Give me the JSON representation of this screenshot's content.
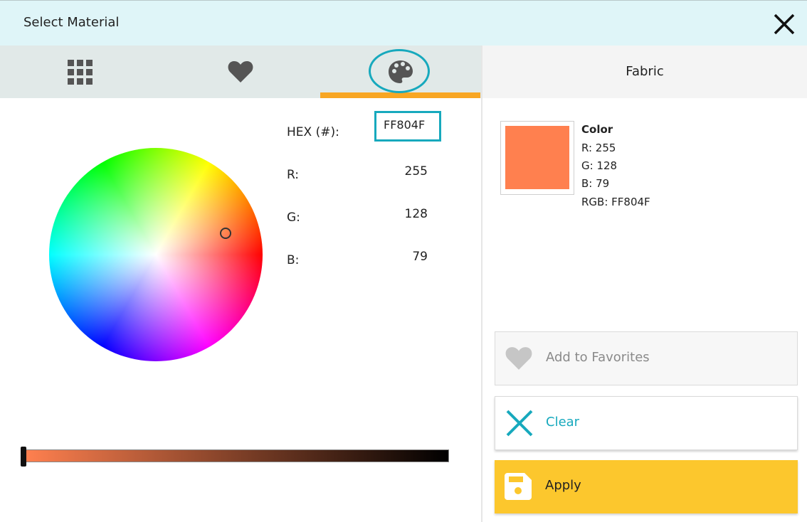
{
  "window": {
    "title": "Select Material"
  },
  "tabs": [
    {
      "name": "grid",
      "icon": "grid-icon"
    },
    {
      "name": "favorites",
      "icon": "heart-icon"
    },
    {
      "name": "color",
      "icon": "palette-icon",
      "active": true
    }
  ],
  "panel": {
    "header": "Fabric"
  },
  "color_fields": {
    "hex_label": "HEX (#):",
    "hex_value": "FF804F",
    "r_label": "R:",
    "r_value": "255",
    "g_label": "G:",
    "g_value": "128",
    "b_label": "B:",
    "b_value": "79"
  },
  "brightness_level": 1.0,
  "color_info": {
    "title": "Color",
    "r": "R: 255",
    "g": "G: 128",
    "b": "B: 79",
    "rgb": "RGB: FF804F",
    "swatch_color": "#FF804F"
  },
  "buttons": {
    "favorites": "Add to Favorites",
    "clear": "Clear",
    "apply": "Apply"
  },
  "colors": {
    "accent": "#17A9BD",
    "tab_underline": "#F8A623",
    "apply_bg": "#FCC72D",
    "titlebar_bg": "#DFF5F8"
  }
}
